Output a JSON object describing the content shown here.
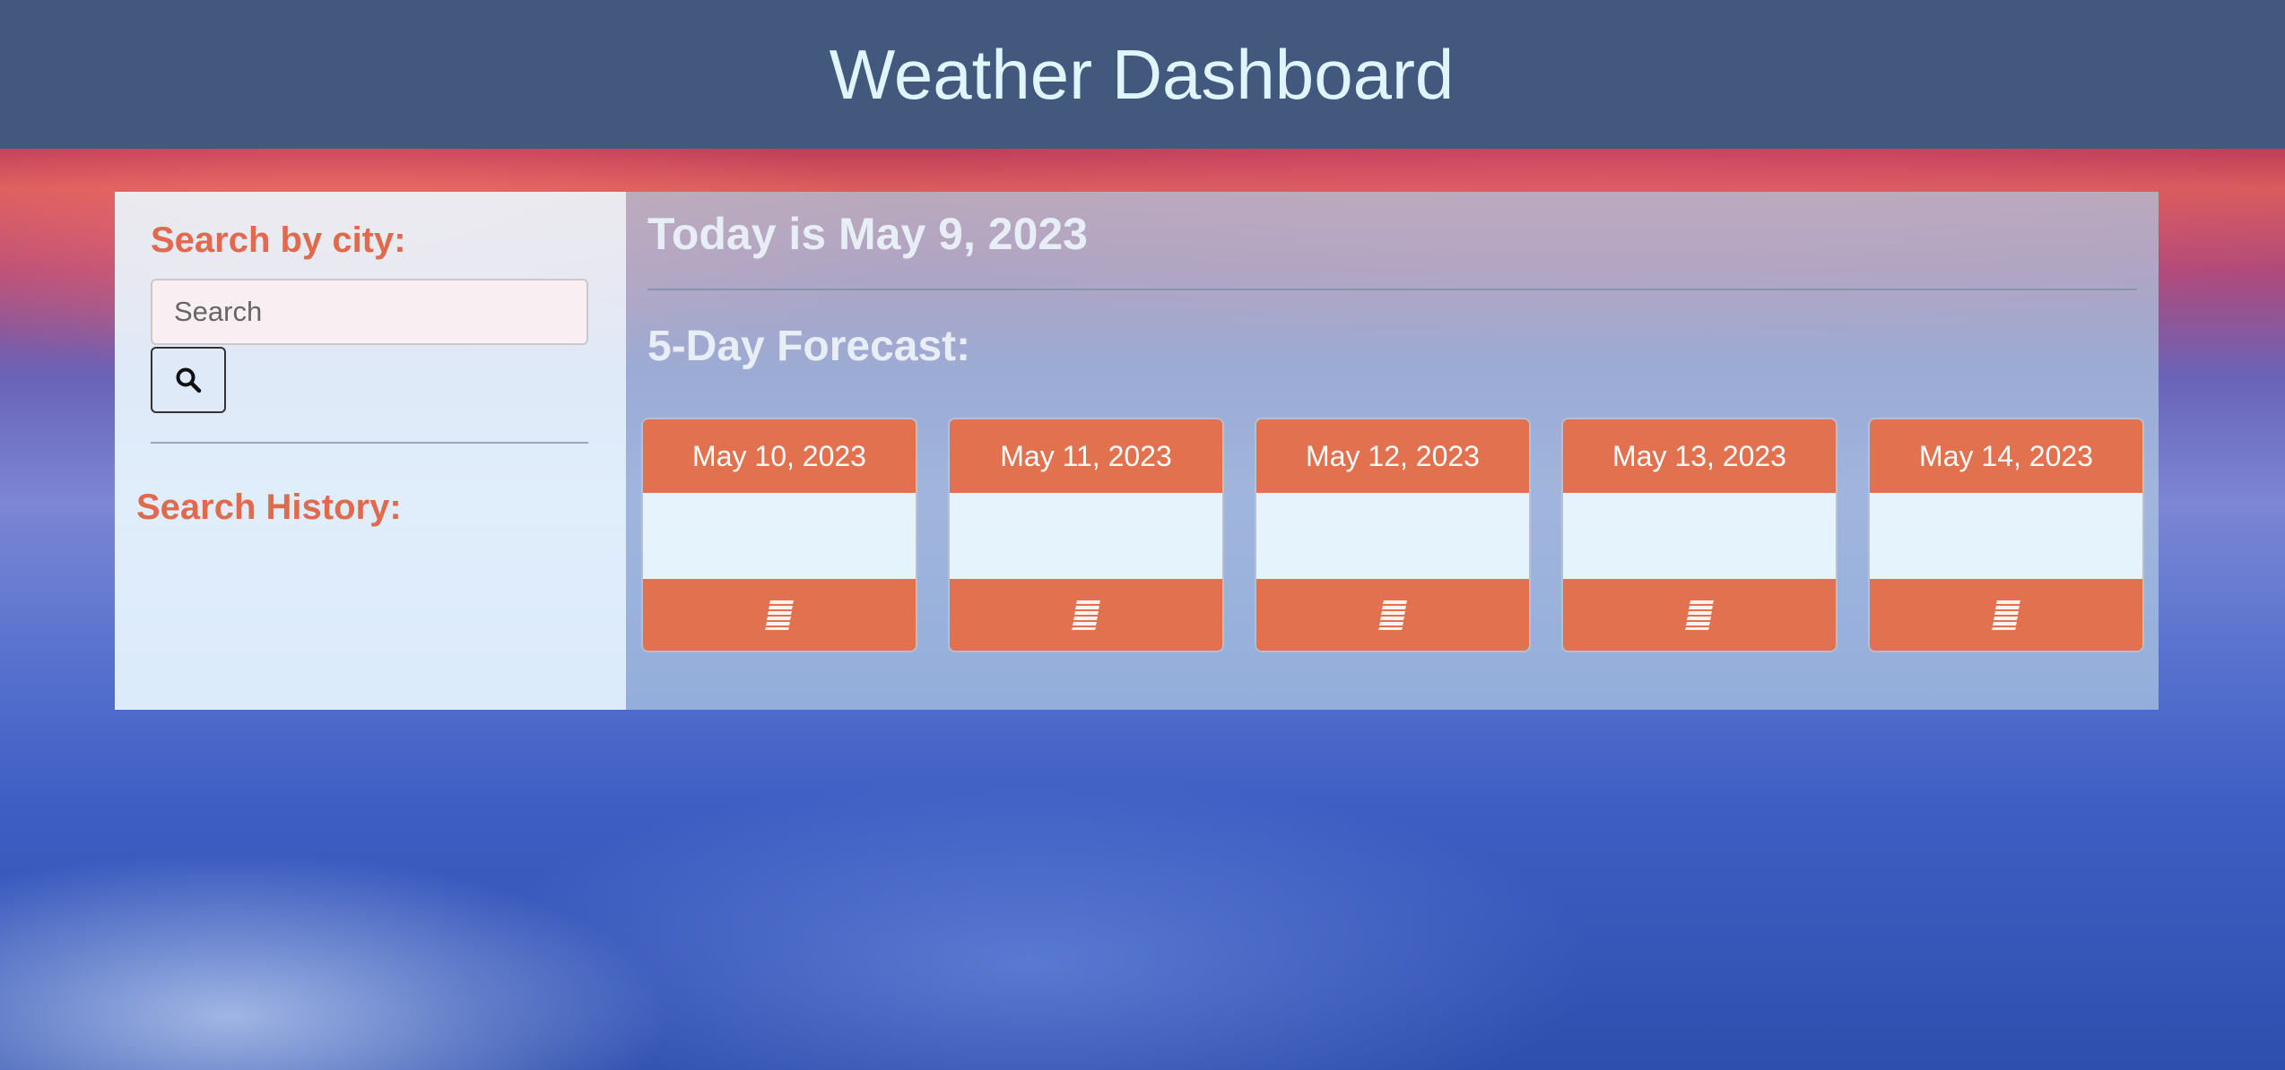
{
  "header": {
    "title": "Weather Dashboard"
  },
  "sidebar": {
    "search_label": "Search by city:",
    "search_placeholder": "Search",
    "search_value": "",
    "history_label": "Search History:"
  },
  "main": {
    "today": "Today is May 9, 2023",
    "forecast_label": "5-Day Forecast:",
    "forecast": [
      {
        "date": "May 10, 2023",
        "icon": "stripes-icon"
      },
      {
        "date": "May 11, 2023",
        "icon": "stripes-icon"
      },
      {
        "date": "May 12, 2023",
        "icon": "stripes-icon"
      },
      {
        "date": "May 13, 2023",
        "icon": "stripes-icon"
      },
      {
        "date": "May 14, 2023",
        "icon": "stripes-icon"
      }
    ]
  },
  "colors": {
    "header_bg": "#42587c",
    "header_text": "#dff5ff",
    "accent": "#e2714f",
    "label_orange": "#e06a4e"
  }
}
